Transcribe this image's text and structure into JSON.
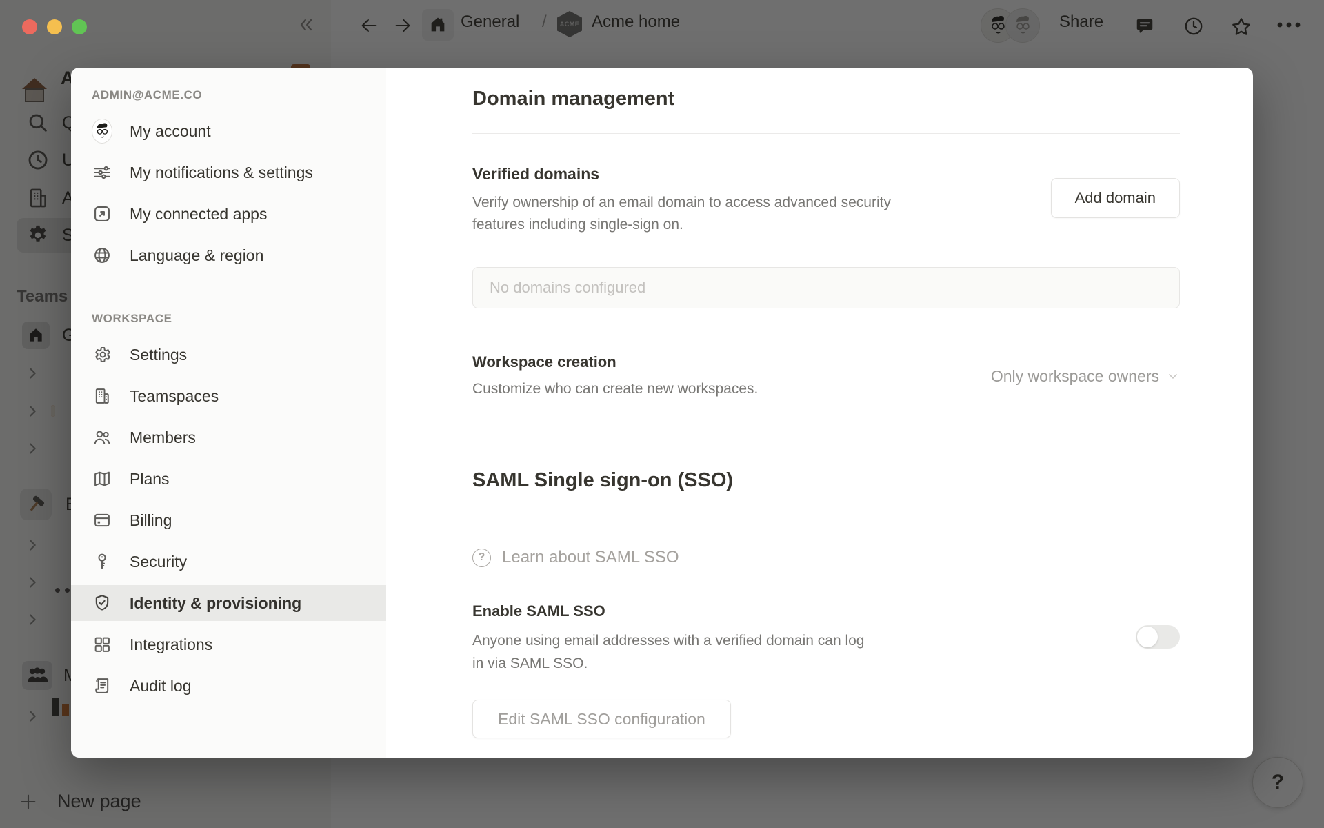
{
  "window": {
    "traffic_lights": {
      "close": "#ed6a5e",
      "minimize": "#f5bf4f",
      "zoom": "#61c454"
    },
    "breadcrumb": {
      "teamspace": "General",
      "separator": "/",
      "page": "Acme home",
      "logo_text": "ACME"
    },
    "share_label": "Share"
  },
  "app_sidebar": {
    "items": [
      {
        "icon": "house-emoji",
        "label": "A"
      },
      {
        "icon": "search",
        "label": "Q"
      },
      {
        "icon": "clock",
        "label": "U"
      },
      {
        "icon": "building",
        "label": "A"
      },
      {
        "icon": "gear",
        "label": "S",
        "active": true
      }
    ],
    "teams_header": "Teams",
    "team_rows": [
      {
        "icon": "home",
        "label": "G"
      },
      {
        "icon": "acme-logo",
        "label": ""
      },
      {
        "icon": "orange-book",
        "label": ""
      },
      {
        "icon": "orange-phone",
        "label": ""
      },
      {
        "icon": "hammer-emoji",
        "label": "E"
      },
      {
        "icon": "calculator",
        "label": ""
      },
      {
        "icon": "robot",
        "label": ""
      },
      {
        "icon": "laptop",
        "label": ""
      },
      {
        "icon": "people",
        "label": "M"
      },
      {
        "icon": "bar-chart",
        "label": ""
      }
    ],
    "new_page_label": "New page"
  },
  "settings_sidebar": {
    "account_header": "ADMIN@ACME.CO",
    "account_items": [
      {
        "label": "My account"
      },
      {
        "label": "My notifications & settings"
      },
      {
        "label": "My connected apps"
      },
      {
        "label": "Language & region"
      }
    ],
    "workspace_header": "WORKSPACE",
    "workspace_items": [
      {
        "label": "Settings"
      },
      {
        "label": "Teamspaces"
      },
      {
        "label": "Members"
      },
      {
        "label": "Plans"
      },
      {
        "label": "Billing"
      },
      {
        "label": "Security"
      },
      {
        "label": "Identity & provisioning",
        "active": true
      },
      {
        "label": "Integrations"
      },
      {
        "label": "Audit log"
      }
    ]
  },
  "content": {
    "domain_management": {
      "title": "Domain management",
      "verified_domains": {
        "title": "Verified domains",
        "description": "Verify ownership of an email domain to access advanced security features including single-sign on.",
        "add_button": "Add domain",
        "empty_state": "No domains configured"
      },
      "workspace_creation": {
        "title": "Workspace creation",
        "description": "Customize who can create new workspaces.",
        "dropdown_value": "Only workspace owners"
      }
    },
    "saml": {
      "title": "SAML Single sign-on (SSO)",
      "learn_link": "Learn about SAML SSO",
      "learn_icon": "?",
      "enable_title": "Enable SAML SSO",
      "enable_description": "Anyone using email addresses with a verified domain can log in via SAML SSO.",
      "toggle_state": "off",
      "edit_button": "Edit SAML SSO configuration"
    }
  },
  "help_button_label": "?"
}
